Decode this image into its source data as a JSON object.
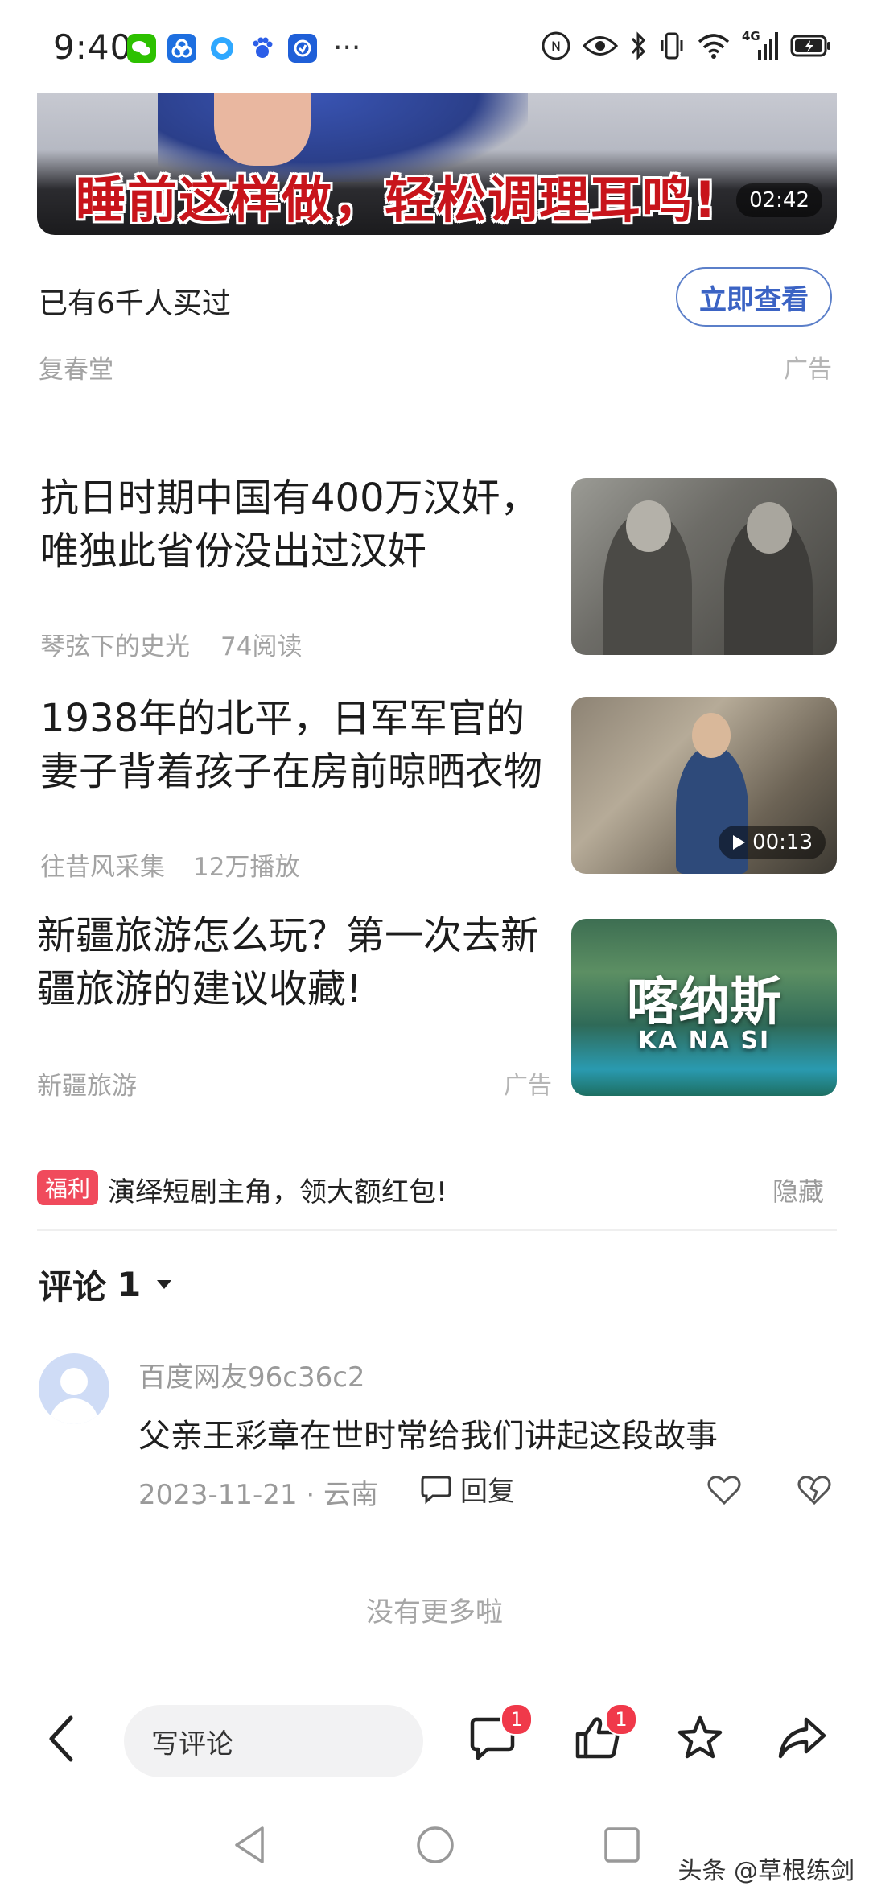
{
  "status_bar": {
    "time": "9:40",
    "more": "···",
    "notification_icons": [
      "wechat-icon",
      "app-icon",
      "qq-browser-icon",
      "baidu-icon",
      "app-store-icon"
    ],
    "system_icons": [
      "nfc-icon",
      "eye-icon",
      "bluetooth-icon",
      "vibrate-icon",
      "wifi-icon",
      "signal-4g-icon",
      "battery-icon"
    ],
    "network_label": "4G"
  },
  "ad": {
    "overlay_text": "睡前这样做，轻松调理耳鸣!",
    "duration": "02:42",
    "meta_text": "已有6千人买过",
    "cta_label": "立即查看",
    "source": "复春堂",
    "ad_label": "广告"
  },
  "feed": [
    {
      "title": "抗日时期中国有400万汉奸，唯独此省份没出过汉奸",
      "source": "琴弦下的史光",
      "stat": "74阅读"
    },
    {
      "title": "1938年的北平，日军军官的妻子背着孩子在房前晾晒衣物",
      "source": "往昔风采集",
      "stat": "12万播放",
      "video_duration": "00:13"
    },
    {
      "title": "新疆旅游怎么玩？第一次去新疆旅游的建议收藏!",
      "source": "新疆旅游",
      "ad_label": "广告",
      "thumb_caption_cn": "喀纳斯",
      "thumb_caption_en": "KA NA SI"
    }
  ],
  "welfare": {
    "badge": "福利",
    "text": "演绎短剧主角，领大额红包!",
    "hide_label": "隐藏"
  },
  "comments": {
    "header": "评论",
    "count": "1",
    "items": [
      {
        "user": "百度网友96c36c2",
        "text": "父亲王彩章在世时常给我们讲起这段故事",
        "date": "2023-11-21 · 云南",
        "reply_label": "回复"
      }
    ],
    "no_more": "没有更多啦"
  },
  "bottom_bar": {
    "comment_placeholder": "写评论",
    "comment_badge": "1",
    "like_badge": "1"
  },
  "watermark": "头条 @草根练剑",
  "colors": {
    "accent": "#3b63c4",
    "badge_red": "#f0394a",
    "welfare_red": "#f04a5c"
  }
}
